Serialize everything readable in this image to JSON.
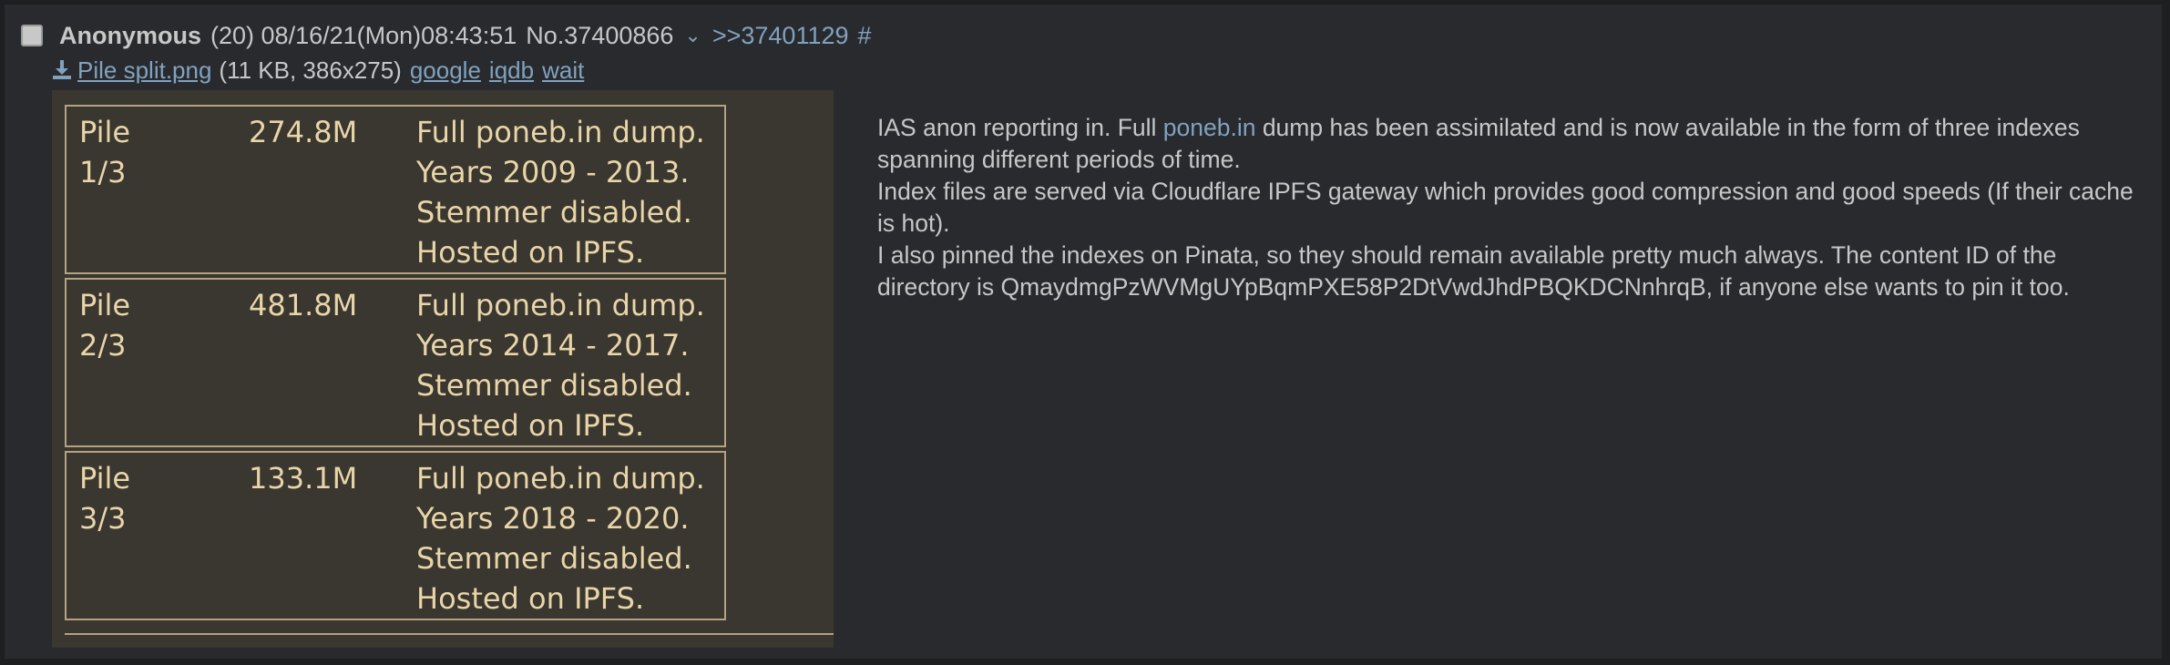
{
  "post": {
    "name": "Anonymous",
    "meta": "(20) 08/16/21(Mon)08:43:51",
    "number": "No.37400866",
    "backlink": ">>37401129",
    "hash": "#"
  },
  "file": {
    "filename": "Pile split.png",
    "info": "(11 KB, 386x275)",
    "links": [
      "google",
      "iqdb",
      "wait"
    ]
  },
  "image": {
    "piles": [
      {
        "name_line1": "Pile",
        "name_line2": "1/3",
        "size": "274.8M",
        "desc": [
          "Full poneb.in dump.",
          "Years 2009 - 2013.",
          "Stemmer disabled.",
          "Hosted on IPFS."
        ]
      },
      {
        "name_line1": "Pile",
        "name_line2": "2/3",
        "size": "481.8M",
        "desc": [
          "Full poneb.in dump.",
          "Years 2014 - 2017.",
          "Stemmer disabled.",
          "Hosted on IPFS."
        ]
      },
      {
        "name_line1": "Pile",
        "name_line2": "3/3",
        "size": "133.1M",
        "desc": [
          "Full poneb.in dump.",
          "Years 2018 - 2020.",
          "Stemmer disabled.",
          "Hosted on IPFS."
        ]
      }
    ]
  },
  "message": {
    "p1_before": "IAS anon reporting in. Full ",
    "p1_link": "poneb.in",
    "p1_after": " dump has been assimilated and is now available in the form of three indexes spanning different periods of time.",
    "p2": "Index files are served via Cloudflare IPFS gateway which provides good compression and good speeds (If their cache is hot).",
    "p3": "I also pinned the indexes on Pinata, so they should remain available pretty much always. The content ID of the directory is QmaydmgPzWVMgUYpBqmPXE58P2DtVwdJhdPBQKDCNnhrqB, if anyone else wants to pin it too."
  }
}
